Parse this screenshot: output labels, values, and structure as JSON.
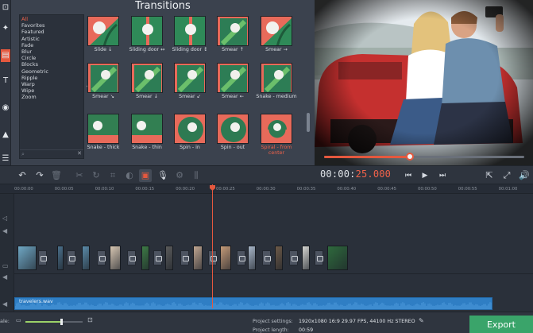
{
  "colors": {
    "accent": "#e5583e",
    "export_green": "#3aa46a",
    "audio_blue": "#2f7ec4",
    "zoom_green": "#9bd268"
  },
  "left_toolbar": [
    {
      "name": "import-icon",
      "glyph": "⊡"
    },
    {
      "name": "magic-wand-icon",
      "glyph": "✦"
    },
    {
      "name": "transitions-icon",
      "glyph": "▤"
    },
    {
      "name": "titles-icon",
      "glyph": "T"
    },
    {
      "name": "stickers-icon",
      "glyph": "◉"
    },
    {
      "name": "shapes-icon",
      "glyph": "▲"
    },
    {
      "name": "menu-icon",
      "glyph": "☰"
    }
  ],
  "transitions": {
    "title": "Transitions",
    "categories": [
      "All",
      "Favorites",
      "Featured",
      "Artistic",
      "Fade",
      "Blur",
      "Circle",
      "Blocks",
      "Geometric",
      "Ripple",
      "Warp",
      "Wipe",
      "Zoom"
    ],
    "selected_category": 0,
    "items": [
      {
        "label": "Slide ↓",
        "img": "bloom",
        "highlight": false
      },
      {
        "label": "Sliding door ↔",
        "img": "split",
        "highlight": false
      },
      {
        "label": "Sliding door ↕",
        "img": "split",
        "highlight": false
      },
      {
        "label": "Smear ↑",
        "img": "smear",
        "highlight": false
      },
      {
        "label": "Smear →",
        "img": "bloom",
        "highlight": false
      },
      {
        "label": "Smear ↘",
        "img": "smear",
        "highlight": false
      },
      {
        "label": "Smear ↓",
        "img": "smear",
        "highlight": false
      },
      {
        "label": "Smear ↙",
        "img": "smear",
        "highlight": false
      },
      {
        "label": "Smear ←",
        "img": "smear",
        "highlight": false
      },
      {
        "label": "Snake - medium",
        "img": "smear",
        "highlight": false
      },
      {
        "label": "Snake - thick",
        "img": "snake",
        "highlight": false
      },
      {
        "label": "Snake - thin",
        "img": "snake",
        "highlight": false
      },
      {
        "label": "Spin - in",
        "img": "spin",
        "highlight": false
      },
      {
        "label": "Spin - out",
        "img": "spin",
        "highlight": false
      },
      {
        "label": "Spiral - from center",
        "img": "spiral",
        "highlight": true
      }
    ]
  },
  "preview": {
    "progress": 0.43
  },
  "toolbar": {
    "timecode_prefix": "00:00:",
    "timecode_suffix": "25.000",
    "tools": [
      {
        "name": "undo-icon",
        "glyph": "↶",
        "dim": false
      },
      {
        "name": "redo-icon",
        "glyph": "↷",
        "dim": false
      },
      {
        "name": "delete-icon",
        "glyph": "🗑",
        "dim": true
      },
      {
        "name": "cut-icon",
        "glyph": "✂",
        "dim": true
      },
      {
        "name": "rotate-icon",
        "glyph": "↻",
        "dim": true
      },
      {
        "name": "crop-icon",
        "glyph": "⌗",
        "dim": true
      },
      {
        "name": "color-adjust-icon",
        "glyph": "◐",
        "dim": true
      },
      {
        "name": "image-icon",
        "glyph": "▣",
        "dim": false
      },
      {
        "name": "microphone-icon",
        "glyph": "🎙",
        "dim": false
      },
      {
        "name": "settings-icon",
        "glyph": "⚙",
        "dim": true
      },
      {
        "name": "equalizer-icon",
        "glyph": "⫼",
        "dim": true
      }
    ],
    "playback": [
      {
        "name": "previous-frame-icon",
        "glyph": "⏮"
      },
      {
        "name": "play-icon",
        "glyph": "▶"
      },
      {
        "name": "next-frame-icon",
        "glyph": "⏭"
      }
    ],
    "right": [
      {
        "name": "detach-icon",
        "glyph": "⇱"
      },
      {
        "name": "fullscreen-icon",
        "glyph": "⤢"
      },
      {
        "name": "volume-icon",
        "glyph": "🔊"
      }
    ]
  },
  "timeline": {
    "ticks": [
      "00:00:00",
      "00:00:05",
      "00:00:10",
      "00:00:15",
      "00:00:20",
      "00:00:25",
      "00:00:30",
      "00:00:35",
      "00:00:40",
      "00:00:45",
      "00:00:50",
      "00:00:55",
      "00:01:00"
    ],
    "audio_label": "travelers.wav"
  },
  "status": {
    "scale_label": "ale:",
    "zoom": 0.63,
    "project_settings_label": "Project settings:",
    "project_settings_value": "1920x1080 16:9 29.97 FPS, 44100 Hz STEREO",
    "project_length_label": "Project length:",
    "project_length_value": "00:59",
    "export_label": "Export"
  }
}
